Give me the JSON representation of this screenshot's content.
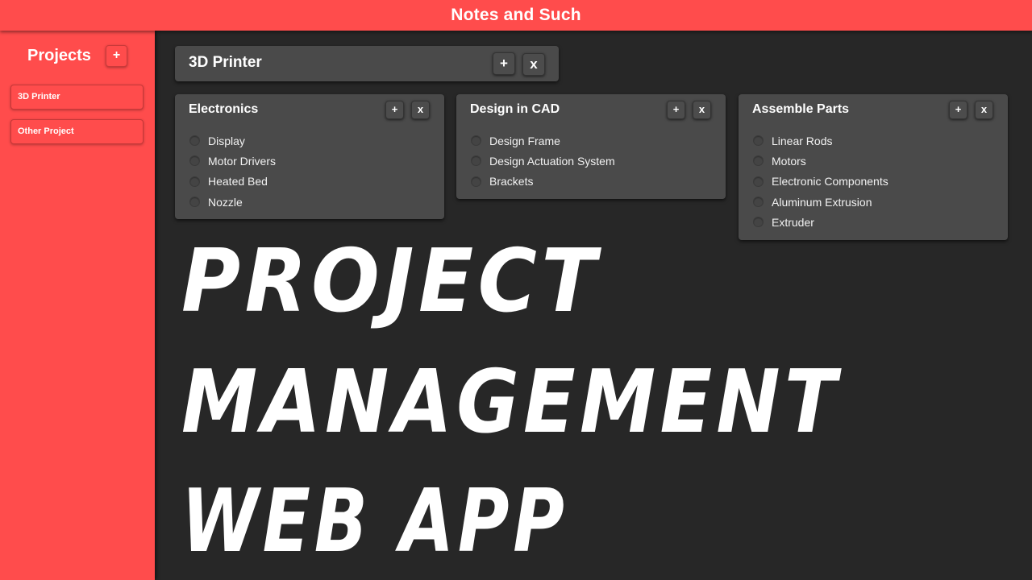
{
  "app": {
    "title": "Notes and Such"
  },
  "sidebar": {
    "title": "Projects",
    "add_label": "+",
    "items": [
      {
        "label": "3D Printer"
      },
      {
        "label": "Other Project"
      }
    ]
  },
  "project": {
    "title": "3D Printer",
    "add_label": "+",
    "close_label": "x"
  },
  "cards": [
    {
      "title": "Electronics",
      "add_label": "+",
      "close_label": "x",
      "tasks": [
        "Display",
        "Motor Drivers",
        "Heated Bed",
        "Nozzle"
      ]
    },
    {
      "title": "Design in CAD",
      "add_label": "+",
      "close_label": "x",
      "tasks": [
        "Design Frame",
        "Design Actuation System",
        "Brackets"
      ]
    },
    {
      "title": "Assemble Parts",
      "add_label": "+",
      "close_label": "x",
      "tasks": [
        "Linear Rods",
        "Motors",
        "Electronic Components",
        "Aluminum Extrusion",
        "Extruder"
      ]
    }
  ],
  "overlay": {
    "line1": "PROJECT",
    "line2": "MANAGEMENT",
    "line3": "WEB APP"
  },
  "colors": {
    "accent": "#ff4c4c",
    "background": "#272727",
    "card": "#4a4a4a"
  }
}
